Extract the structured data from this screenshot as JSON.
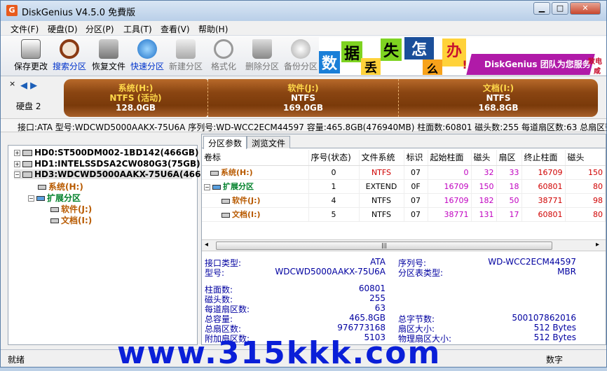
{
  "window": {
    "title": "DiskGenius V4.5.0 免費版",
    "icon": "G"
  },
  "menu": [
    "文件(F)",
    "硬盘(D)",
    "分区(P)",
    "工具(T)",
    "查看(V)",
    "帮助(H)"
  ],
  "toolbar": [
    {
      "label": "保存更改",
      "icon": "save-icon"
    },
    {
      "label": "搜索分区",
      "icon": "search-icon"
    },
    {
      "label": "恢复文件",
      "icon": "recover-icon"
    },
    {
      "label": "快速分区",
      "icon": "quick-partition-icon"
    },
    {
      "label": "新建分区",
      "icon": "new-partition-icon"
    },
    {
      "label": "格式化",
      "icon": "format-icon"
    },
    {
      "label": "删除分区",
      "icon": "delete-icon"
    },
    {
      "label": "备份分区",
      "icon": "backup-icon"
    }
  ],
  "banner": {
    "chars": [
      "数",
      "据",
      "丢",
      "失",
      "怎",
      "么",
      "办",
      "!"
    ],
    "slogan": "DiskGenius 团队为您服务",
    "side1": "致电",
    "side2": "咸"
  },
  "disk_label": "硬盘 2",
  "partitions_bar": [
    {
      "name": "系统(H:)",
      "fs": "NTFS (活动)",
      "size": "128.0GB"
    },
    {
      "name": "软件(J:)",
      "fs": "NTFS",
      "size": "169.0GB"
    },
    {
      "name": "文档(I:)",
      "fs": "NTFS",
      "size": "168.8GB"
    }
  ],
  "infobar": "接口:ATA  型号:WDCWD5000AAKX-75U6A  序列号:WD-WCC2ECM44597  容量:465.8GB(476940MB)  柱面数:60801  磁头数:255  每道扇区数:63  总扇区数:97673",
  "tree": {
    "disks": [
      "HD0:ST500DM002-1BD142(466GB)",
      "HD1:INTELSSDSA2CW080G3(75GB)",
      "HD3:WDCWD5000AAKX-75U6A(466GB)"
    ],
    "parts": [
      "系统(H:)",
      "扩展分区",
      "软件(J:)",
      "文档(I:)"
    ]
  },
  "tabs": [
    "分区参数",
    "浏览文件"
  ],
  "table": {
    "headers": [
      "卷标",
      "序号(状态)",
      "文件系统",
      "标识",
      "起始柱面",
      "磁头",
      "扇区",
      "终止柱面",
      "磁头"
    ],
    "rows": [
      [
        "系统(H:)",
        "0",
        "NTFS",
        "07",
        "0",
        "32",
        "33",
        "16709",
        "150"
      ],
      [
        "扩展分区",
        "1",
        "EXTEND",
        "0F",
        "16709",
        "150",
        "18",
        "60801",
        "80"
      ],
      [
        "软件(J:)",
        "4",
        "NTFS",
        "07",
        "16709",
        "182",
        "50",
        "38771",
        "98"
      ],
      [
        "文档(I:)",
        "5",
        "NTFS",
        "07",
        "38771",
        "131",
        "17",
        "60801",
        "80"
      ]
    ]
  },
  "details": {
    "iface_label": "接口类型:",
    "iface": "ATA",
    "model_label": "型号:",
    "model": "WDCWD5000AAKX-75U6A",
    "serial_label": "序列号:",
    "serial": "WD-WCC2ECM44597",
    "ptype_label": "分区表类型:",
    "ptype": "MBR",
    "cyl_label": "柱面数:",
    "cyl": "60801",
    "heads_label": "磁头数:",
    "heads": "255",
    "spt_label": "每道扇区数:",
    "spt": "63",
    "cap_label": "总容量:",
    "cap": "465.8GB",
    "bytes_label": "总字节数:",
    "bytes": "500107862016",
    "sect_label": "总扇区数:",
    "sect": "976773168",
    "ssize_label": "扇区大小:",
    "ssize": "512 Bytes",
    "extra_label": "附加扇区数:",
    "extra": "5103",
    "psize_label": "物理扇区大小:",
    "psize": "512 Bytes"
  },
  "status": {
    "left": "就绪",
    "right": "数字"
  },
  "watermark": "www.315kkk.com"
}
